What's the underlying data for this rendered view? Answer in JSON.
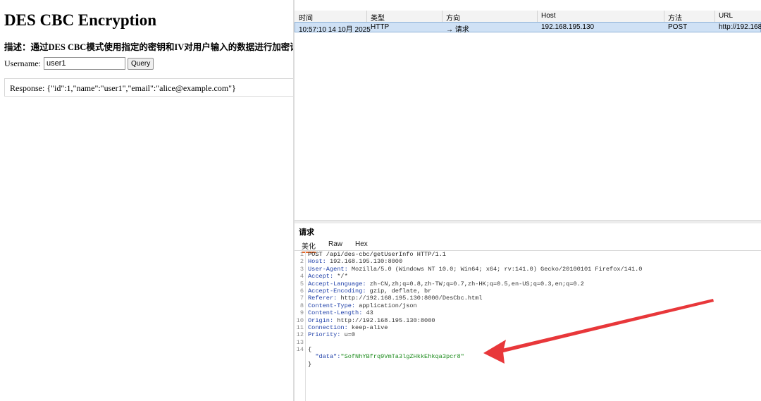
{
  "left": {
    "title": "DES CBC Encryption",
    "description": "描述：通过DES CBC模式使用指定的密钥和IV对用户输入的数据进行加密请求，",
    "username_label": "Username:",
    "username_value": "user1",
    "query_button": "Query",
    "response_text": "Response: {\"id\":1,\"name\":\"user1\",\"email\":\"alice@example.com\"}"
  },
  "history": {
    "columns": [
      "时间",
      "类型",
      "方向",
      "Host",
      "方法",
      "URL"
    ],
    "row": {
      "time": "10:57:10 14 10月 2025",
      "type": "HTTP",
      "direction": "→ 请求",
      "host": "192.168.195.130",
      "method": "POST",
      "url": "http://192.168"
    }
  },
  "request_pane": {
    "title": "请求",
    "tabs": [
      "美化",
      "Raw",
      "Hex"
    ],
    "active_tab": "美化",
    "lines": [
      {
        "n": "1",
        "text": "POST /api/des-cbc/getUserInfo HTTP/1.1"
      },
      {
        "n": "2",
        "key": "Host:",
        "value": " 192.168.195.130:8000"
      },
      {
        "n": "3",
        "key": "User-Agent:",
        "value": " Mozilla/5.0 (Windows NT 10.0; Win64; x64; rv:141.0) Gecko/20100101 Firefox/141.0"
      },
      {
        "n": "4",
        "key": "Accept:",
        "value": " */*"
      },
      {
        "n": "5",
        "key": "Accept-Language:",
        "value": " zh-CN,zh;q=0.8,zh-TW;q=0.7,zh-HK;q=0.5,en-US;q=0.3,en;q=0.2"
      },
      {
        "n": "6",
        "key": "Accept-Encoding:",
        "value": " gzip, deflate, br"
      },
      {
        "n": "7",
        "key": "Referer:",
        "value": " http://192.168.195.130:8000/DesCbc.html"
      },
      {
        "n": "8",
        "key": "Content-Type:",
        "value": " application/json"
      },
      {
        "n": "9",
        "key": "Content-Length:",
        "value": " 43"
      },
      {
        "n": "10",
        "key": "Origin:",
        "value": " http://192.168.195.130:8000"
      },
      {
        "n": "11",
        "key": "Connection:",
        "value": " keep-alive"
      },
      {
        "n": "12",
        "key": "Priority:",
        "value": " u=0"
      },
      {
        "n": "13",
        "text": ""
      },
      {
        "n": "14",
        "text": "{"
      },
      {
        "n": "",
        "jkey": "  \"data\":",
        "jstr": "\"SofNhYBfrq9VmTa3lgZHkkEhkqa3pcr8\""
      },
      {
        "n": "",
        "text": "}"
      }
    ]
  },
  "annotation": {
    "arrow_color": "#e8373a"
  }
}
